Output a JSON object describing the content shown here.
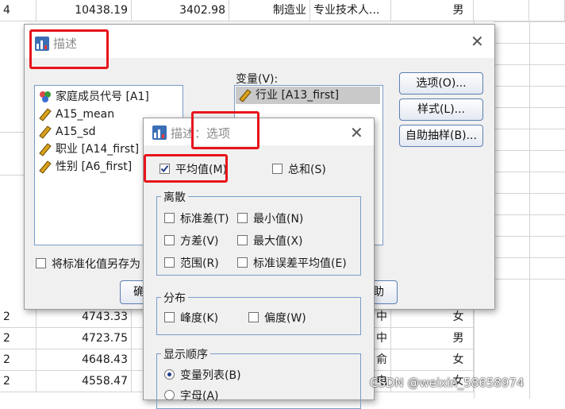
{
  "colors": {
    "accent": "#e8141b",
    "selection": "#c9c9c9",
    "border_blue": "#7a9cc8"
  },
  "spreadsheet": {
    "rows": [
      {
        "c1": "4",
        "c2": "10438.19",
        "c3": "3402.98",
        "c4": "制造业",
        "c5": "专业技术人...",
        "c6": "男"
      },
      {
        "c1": "2",
        "c2": "4743.33",
        "c3": "",
        "c4": "",
        "c5": "",
        "c6": "女"
      },
      {
        "c1": "2",
        "c2": "4723.75",
        "c3": "",
        "c4": "",
        "c5": "",
        "c6": "男"
      },
      {
        "c1": "2",
        "c2": "4648.43",
        "c3": "",
        "c4": "",
        "c5": "",
        "c6": "女"
      },
      {
        "c1": "2",
        "c2": "4558.47",
        "c3": "",
        "c4": "",
        "c5": "",
        "c6": "女"
      }
    ],
    "partial_labels": [
      "中",
      "中",
      "俞",
      "电"
    ]
  },
  "main_dialog": {
    "title": "描述",
    "close_icon": "close-icon",
    "variables_label": "变量(V):",
    "source_list": [
      {
        "icon": "nominal-icon",
        "label": "家庭成员代号 [A1]"
      },
      {
        "icon": "scale-icon",
        "label": "A15_mean"
      },
      {
        "icon": "scale-icon",
        "label": "A15_sd"
      },
      {
        "icon": "scale-icon",
        "label": "职业 [A14_first]"
      },
      {
        "icon": "scale-icon",
        "label": "性别 [A6_first]"
      }
    ],
    "target_list": [
      {
        "icon": "scale-icon",
        "label": "行业 [A13_first]"
      }
    ],
    "buttons": {
      "options": "选项(O)...",
      "style": "样式(L)...",
      "bootstrap": "自助抽样(B)..."
    },
    "save_standardized": "将标准化值另存为",
    "ok_partial": "确",
    "help_partial": "助"
  },
  "options_dialog": {
    "title": "描述：选项",
    "mean": {
      "label": "平均值(M)",
      "checked": true
    },
    "sum": {
      "label": "总和(S)",
      "checked": false
    },
    "dispersion": {
      "title": "离散",
      "items": [
        {
          "label": "标准差(T)",
          "checked": false
        },
        {
          "label": "最小值(N)",
          "checked": false
        },
        {
          "label": "方差(V)",
          "checked": false
        },
        {
          "label": "最大值(X)",
          "checked": false
        },
        {
          "label": "范围(R)",
          "checked": false
        },
        {
          "label": "标准误差平均值(E)",
          "checked": false
        }
      ]
    },
    "distribution": {
      "title": "分布",
      "items": [
        {
          "label": "峰度(K)",
          "checked": false
        },
        {
          "label": "偏度(W)",
          "checked": false
        }
      ]
    },
    "display_order": {
      "title": "显示顺序",
      "items": [
        {
          "label": "变量列表(B)",
          "selected": true
        },
        {
          "label": "字母(A)",
          "selected": false
        }
      ]
    }
  },
  "watermark": "CSDN @weixin_58658974"
}
